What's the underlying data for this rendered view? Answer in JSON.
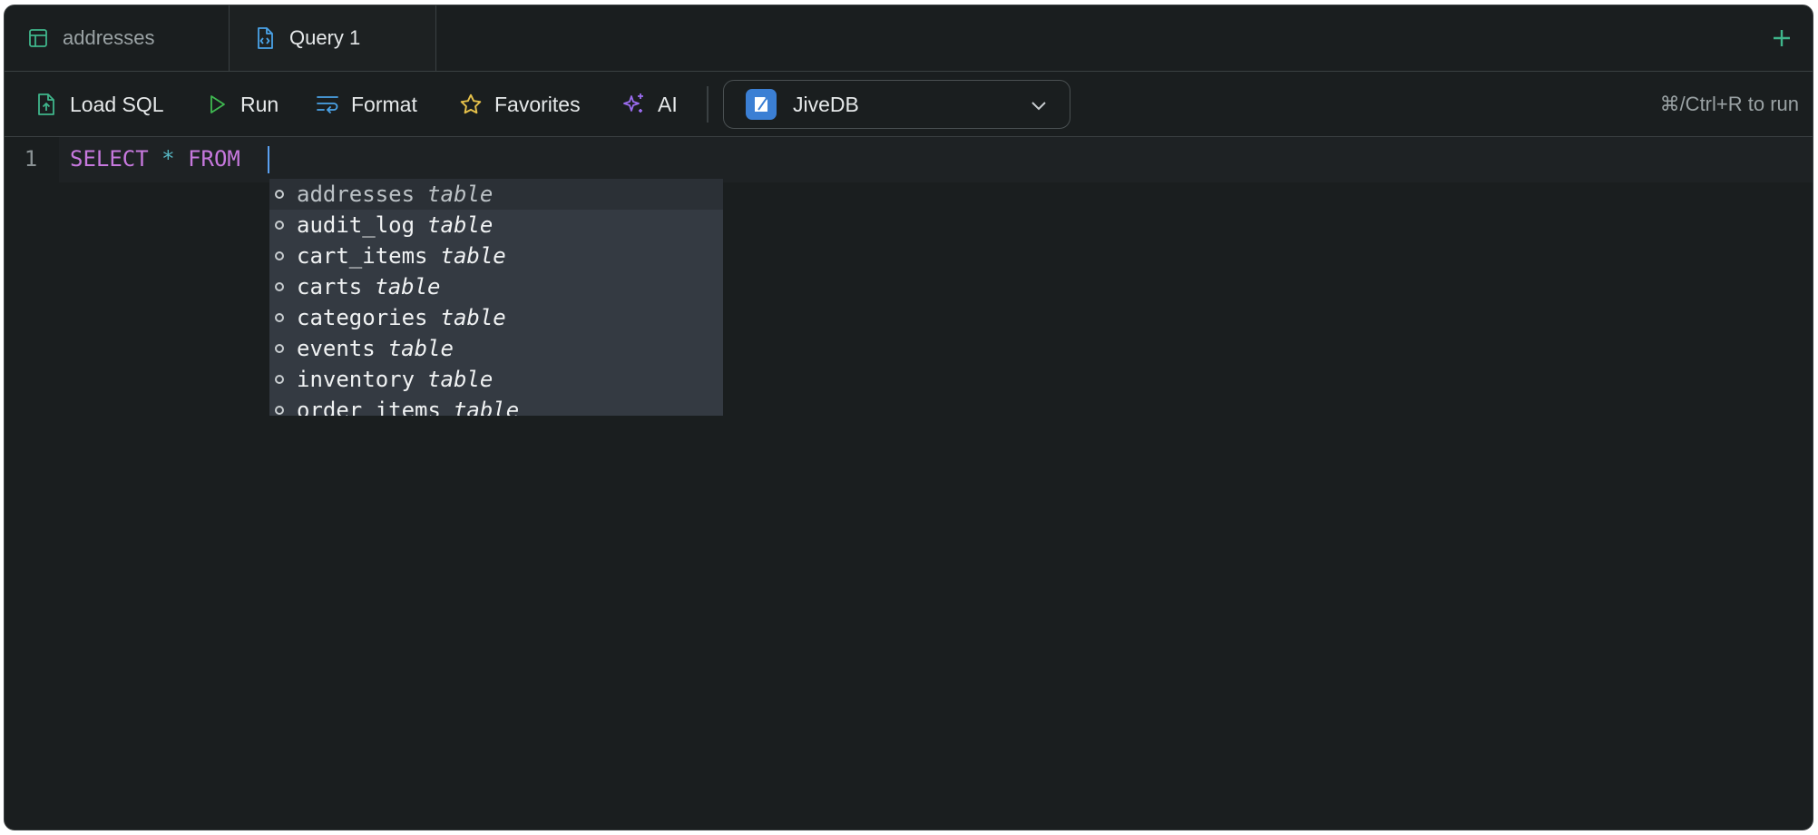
{
  "tabs": [
    {
      "label": "addresses",
      "icon": "table-icon"
    },
    {
      "label": "Query 1",
      "icon": "sql-file-icon"
    }
  ],
  "toolbar": {
    "load_sql": "Load SQL",
    "run": "Run",
    "format": "Format",
    "favorites": "Favorites",
    "ai": "AI",
    "database": "JiveDB",
    "hint": "⌘/Ctrl+R to run"
  },
  "editor": {
    "line_number": "1",
    "keyword_select": "SELECT",
    "operator_star": "*",
    "keyword_from": "FROM"
  },
  "autocomplete": [
    {
      "name": "addresses",
      "type": "table"
    },
    {
      "name": "audit_log",
      "type": "table"
    },
    {
      "name": "cart_items",
      "type": "table"
    },
    {
      "name": "carts",
      "type": "table"
    },
    {
      "name": "categories",
      "type": "table"
    },
    {
      "name": "events",
      "type": "table"
    },
    {
      "name": "inventory",
      "type": "table"
    },
    {
      "name": "order_items",
      "type": "table"
    }
  ],
  "colors": {
    "accent_green": "#3fb68b",
    "keyword": "#c678dd",
    "operator": "#56b6c2",
    "run_icon": "#3fb950",
    "format_icon": "#4aa3e8",
    "favorites_icon": "#e5c04a",
    "ai_icon": "#9b6cf0"
  }
}
